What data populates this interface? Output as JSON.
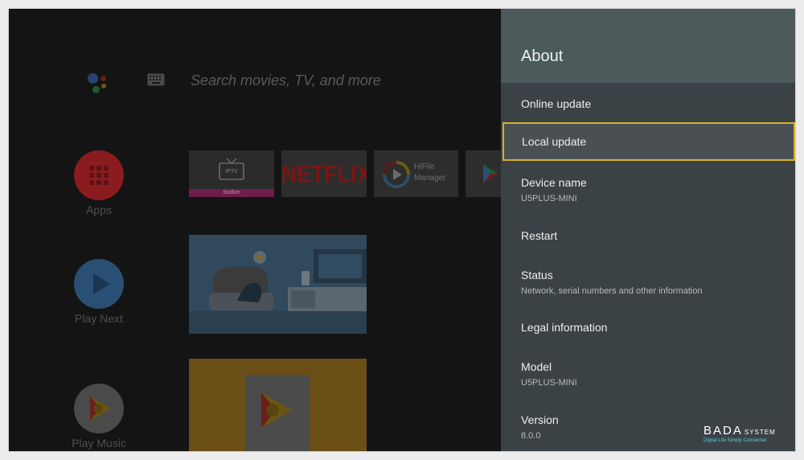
{
  "search": {
    "placeholder": "Search movies, TV, and more"
  },
  "rail": [
    {
      "label": "Apps",
      "color": "#8a1c20"
    },
    {
      "label": "Play Next",
      "color": "#2a4f74"
    },
    {
      "label": "Play Music",
      "color": "#4a4a4a"
    }
  ],
  "tiles": {
    "iptv": {
      "logo": "IPTV",
      "caption": "Stalker"
    },
    "netflix": {
      "logo": "NETFLIX"
    },
    "hifile": {
      "line1": "HiFile",
      "line2": "Manager"
    }
  },
  "panel": {
    "title": "About",
    "items": [
      {
        "title": "Online update"
      },
      {
        "title": "Local update",
        "selected": true
      },
      {
        "title": "Device name",
        "subtitle": "U5PLUS-MINI"
      },
      {
        "title": "Restart"
      },
      {
        "title": "Status",
        "subtitle": "Network, serial numbers and other information"
      },
      {
        "title": "Legal information"
      },
      {
        "title": "Model",
        "subtitle": "U5PLUS-MINI"
      },
      {
        "title": "Version",
        "subtitle": "8.0.0"
      }
    ]
  },
  "watermark": {
    "brand": "BADA",
    "brand_suffix": "SYSTEM",
    "tagline": "Digital Life Simply Connected"
  },
  "colors": {
    "selection_border": "#d6b22a",
    "panel_bg": "#3b4246",
    "panel_header_bg": "#4c5a5c"
  },
  "icons": {
    "assistant": "google-assistant-icon",
    "keyboard": "keyboard-icon",
    "apps": "apps-grid-icon",
    "play_next": "play-icon",
    "play_music": "play-music-icon"
  }
}
